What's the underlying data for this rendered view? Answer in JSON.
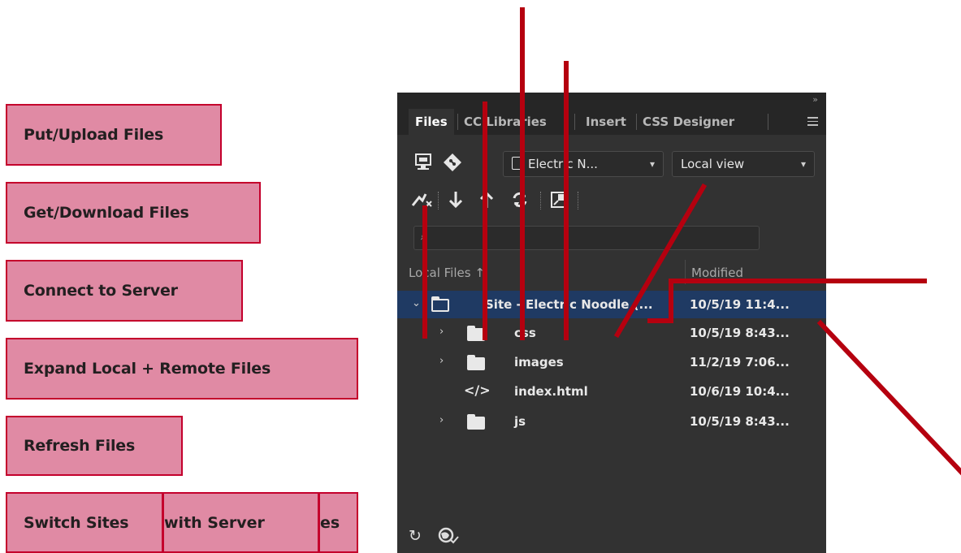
{
  "callouts": {
    "put": "Put/Upload Files",
    "get": "Get/Download Files",
    "connect": "Connect to Server",
    "expand": "Expand Local + Remote Files",
    "refresh": "Refresh Files",
    "switch": "Switch Sites",
    "sync_mid": "with Server",
    "sync_tail": "es"
  },
  "panel": {
    "collapse_glyph": "»",
    "tabs": [
      {
        "label": "Files"
      },
      {
        "label": "CC Libraries"
      },
      {
        "label": "Insert"
      },
      {
        "label": "CSS Designer"
      }
    ],
    "site_dropdown": "Electric N...",
    "view_dropdown": "Local view",
    "search_placeholder": "",
    "columns": {
      "local": "Local Files ↑",
      "modified": "Modified"
    },
    "rows": [
      {
        "name": "Site - Electric Noodle (...",
        "modified": "10/5/19 11:4...",
        "type": "site"
      },
      {
        "name": "css",
        "modified": "10/5/19 8:43...",
        "type": "folder"
      },
      {
        "name": "images",
        "modified": "11/2/19 7:06...",
        "type": "folder"
      },
      {
        "name": "index.html",
        "modified": "10/6/19 10:4...",
        "type": "file"
      },
      {
        "name": "js",
        "modified": "10/5/19 8:43...",
        "type": "folder"
      }
    ]
  },
  "colors": {
    "callout_fill": "#e08aa4",
    "callout_border": "#c4002c",
    "line": "#b5000f",
    "panel_bg": "#323232"
  }
}
